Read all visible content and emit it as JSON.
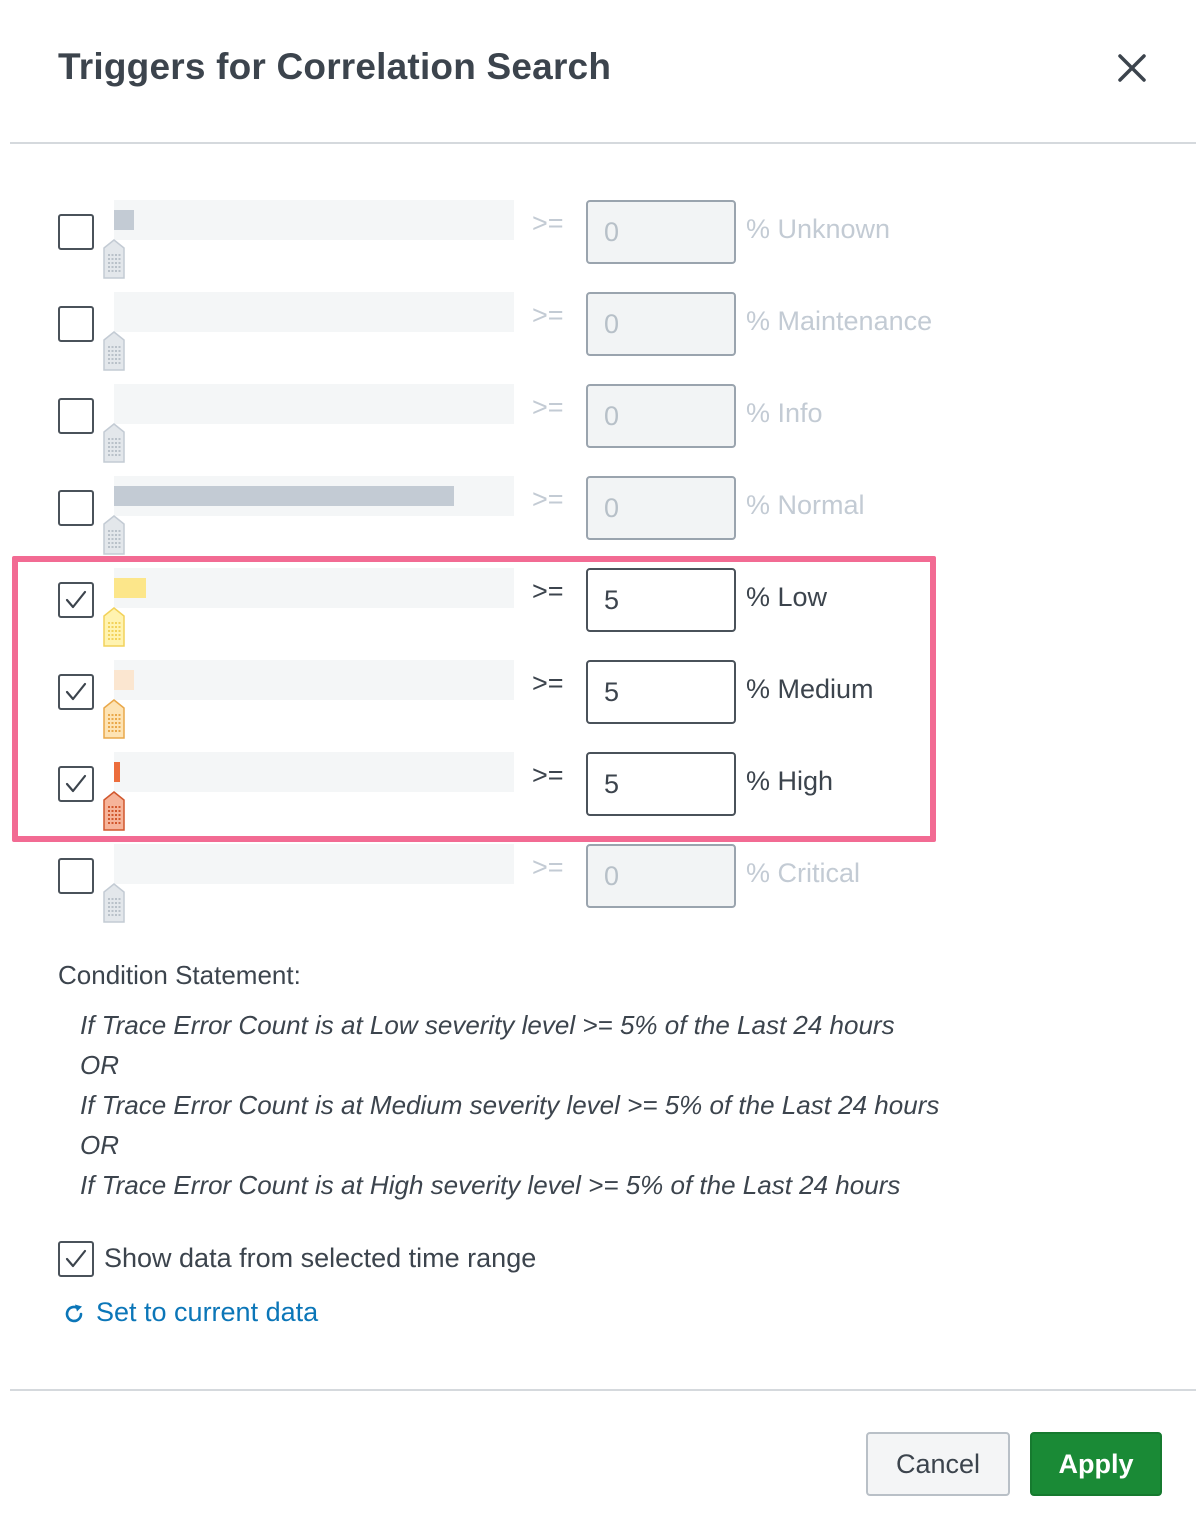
{
  "dialog": {
    "title": "Triggers for Correlation Search"
  },
  "operator": ">=",
  "rows": [
    {
      "level": "% Unknown",
      "value": "0",
      "checked": false,
      "color": "#c3cbd4",
      "fill_fraction": 0.05
    },
    {
      "level": "% Maintenance",
      "value": "0",
      "checked": false,
      "color": "#c3cbd4",
      "fill_fraction": 0.0
    },
    {
      "level": "% Info",
      "value": "0",
      "checked": false,
      "color": "#c3cbd4",
      "fill_fraction": 0.0
    },
    {
      "level": "% Normal",
      "value": "0",
      "checked": false,
      "color": "#c3cbd4",
      "fill_fraction": 0.85
    },
    {
      "level": "% Low",
      "value": "5",
      "checked": true,
      "color": "#fce68a",
      "fill_fraction": 0.08
    },
    {
      "level": "% Medium",
      "value": "5",
      "checked": true,
      "color": "#fbe6d0",
      "fill_fraction": 0.05
    },
    {
      "level": "% High",
      "value": "5",
      "checked": true,
      "color": "#ec6d3c",
      "fill_fraction": 0.015
    },
    {
      "level": "% Critical",
      "value": "0",
      "checked": false,
      "color": "#c3cbd4",
      "fill_fraction": 0.0
    }
  ],
  "condition": {
    "title": "Condition Statement:",
    "lines": [
      "If Trace Error Count is at Low severity level >= 5% of the Last 24 hours",
      "OR",
      "If Trace Error Count is at Medium severity level >= 5% of the Last 24 hours",
      "OR",
      "If Trace Error Count is at High severity level >= 5% of the Last 24 hours"
    ]
  },
  "options": {
    "show_data_label": "Show data from selected time range",
    "show_data_checked": true,
    "set_current_label": "Set to current data"
  },
  "footer": {
    "cancel_label": "Cancel",
    "apply_label": "Apply"
  },
  "colors": {
    "accent_link": "#0b76b8",
    "apply_green": "#1a8a36",
    "highlight_pink": "#f26b93"
  }
}
